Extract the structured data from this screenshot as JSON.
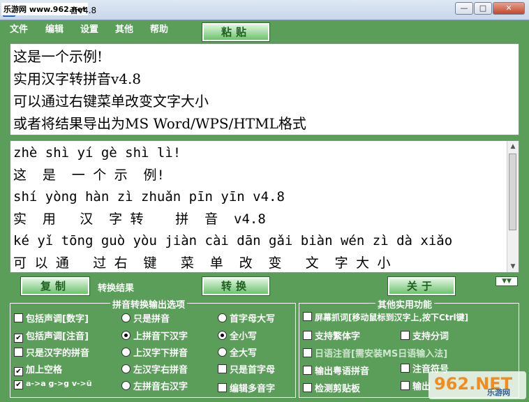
{
  "window": {
    "watermark": "乐游网 www.962.net",
    "title_suffix": "音v4.8",
    "minimize": "—",
    "maximize": "□",
    "close": "✕"
  },
  "menu": [
    "文件",
    "编辑",
    "设置",
    "其他",
    "帮助"
  ],
  "paste_button": "粘贴",
  "input_lines": [
    "这是一个示例!",
    "实用汉字转拼音v4.8",
    "可以通过右键菜单改变文字大小",
    "或者将结果导出为MS Word/WPS/HTML格式"
  ],
  "output_lines": [
    "zhè shì yí gè shì lì!",
    "这  是  一 个 示  例!",
    "shí yòng hàn zì zhuǎn pīn yīn v4.8",
    "实  用   汉  字 转    拼  音  v4.8",
    "ké yǐ tōng guò yòu jiàn cài dān gǎi biàn wén zì dà xiǎo",
    "可 以 通   过 右  键   菜  单  改  变   文  字 大 小"
  ],
  "copy_button": "复制",
  "convert_result_label": "转换结果",
  "convert_button": "转换",
  "about_button": "关于",
  "pinyin_options": {
    "title": "拼音转换输出选项",
    "col1": [
      {
        "label": "包括声调[数字]",
        "checked": false
      },
      {
        "label": "包括声调[注音]",
        "checked": true
      },
      {
        "label": "只是汉字的拼音",
        "checked": false
      },
      {
        "label": "加上空格",
        "checked": true
      },
      {
        "label": "a->a g->g v->ü",
        "checked": true
      }
    ],
    "col2": [
      {
        "label": "只是拼音",
        "checked": false
      },
      {
        "label": "上拼音下汉字",
        "checked": true
      },
      {
        "label": "上汉字下拼音",
        "checked": false
      },
      {
        "label": "左汉字右拼音",
        "checked": false
      },
      {
        "label": "左拼音右汉字",
        "checked": false
      }
    ],
    "col3": [
      {
        "label": "首字母大写",
        "type": "radio",
        "checked": false
      },
      {
        "label": "全小写",
        "type": "radio",
        "checked": true
      },
      {
        "label": "全大写",
        "type": "radio",
        "checked": false
      },
      {
        "label": "只是首字母",
        "type": "check",
        "checked": false
      },
      {
        "label": "编辑多音字",
        "type": "check",
        "checked": false
      }
    ]
  },
  "other_functions": {
    "title": "其他实用功能",
    "items": [
      {
        "label": "屏幕抓词[移动鼠标到汉字上,按下Ctrl键]",
        "checked": false,
        "disabled": false
      },
      {
        "label": "支持繁体字",
        "checked": false,
        "disabled": false
      },
      {
        "label": "支持分词",
        "checked": false,
        "disabled": false
      },
      {
        "label": "日语注音[需安装MS日语输入法]",
        "checked": false,
        "disabled": true
      },
      {
        "label": "输出粤语拼音",
        "checked": false,
        "disabled": false
      },
      {
        "label": "注音符号",
        "checked": false,
        "disabled": false
      },
      {
        "label": "检测剪贴板",
        "checked": false,
        "disabled": false
      },
      {
        "label": "输出",
        "checked": false,
        "disabled": false
      }
    ]
  },
  "logo": {
    "main": "962.NET",
    "sub": "乐游网"
  }
}
